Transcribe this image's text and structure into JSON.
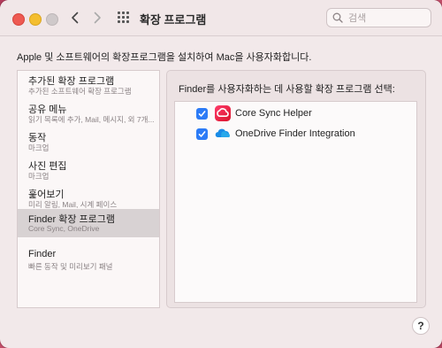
{
  "window": {
    "title": "확장 프로그램",
    "search": {
      "placeholder": "검색",
      "value": ""
    }
  },
  "description": "Apple 및 소프트웨어의 확장프로그램을 설치하여 Mac을 사용자화합니다.",
  "sidebar": {
    "items": [
      {
        "title": "추가된 확장 프로그램",
        "subtitle": "추가된 소프트웨어 확장 프로그램",
        "selected": false
      },
      {
        "title": "공유 메뉴",
        "subtitle": "읽기 목록에 추가, Mail, 메시지, 외 7개...",
        "selected": false
      },
      {
        "title": "동작",
        "subtitle": "마크업",
        "selected": false
      },
      {
        "title": "사진 편집",
        "subtitle": "마크업",
        "selected": false
      },
      {
        "title": "훑어보기",
        "subtitle": "미리 알림, Mail, 시계 페이스",
        "selected": false
      },
      {
        "title": "Finder 확장 프로그램",
        "subtitle": "Core Sync, OneDrive",
        "selected": true
      },
      {
        "title": "Finder",
        "subtitle": "빠른 동작 및 미리보기 패널",
        "selected": false
      }
    ]
  },
  "panel": {
    "title": "Finder를 사용자화하는 데 사용할 확장 프로그램 선택:",
    "extensions": [
      {
        "label": "Core Sync Helper",
        "checked": true,
        "icon": "adobe-creative-cloud-icon"
      },
      {
        "label": "OneDrive Finder Integration",
        "checked": true,
        "icon": "onedrive-cloud-icon"
      }
    ]
  },
  "help_label": "?",
  "colors": {
    "accent": "#2c7bf6",
    "selected_row": "#d8d2d3",
    "window_bg": "#f2e9ea"
  }
}
